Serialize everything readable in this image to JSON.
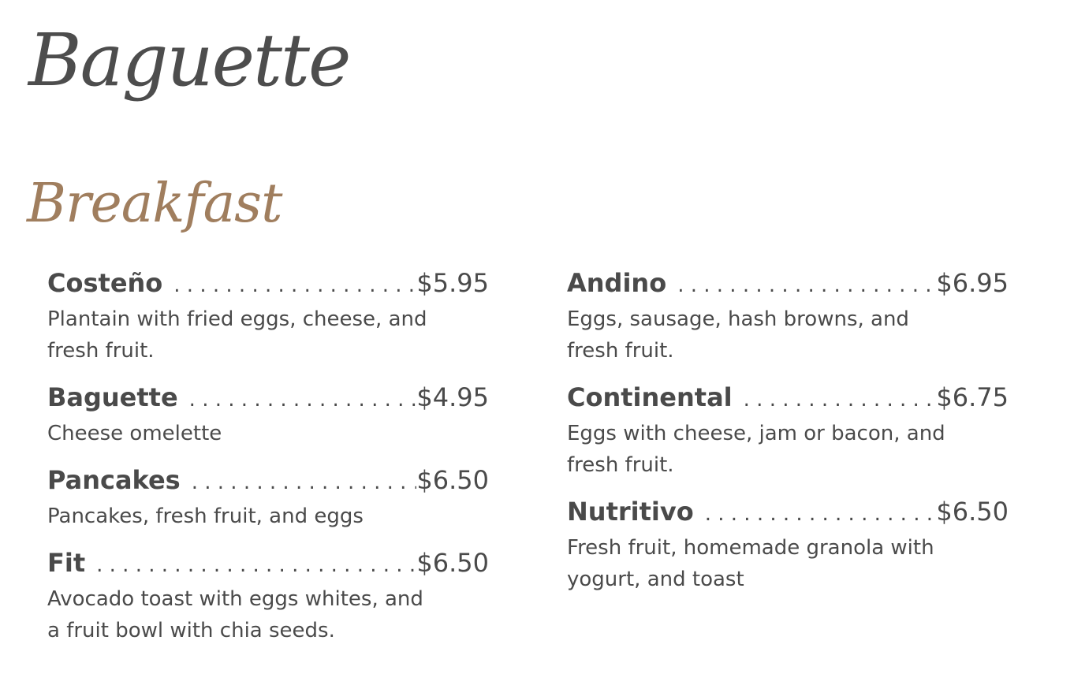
{
  "brand": {
    "name": "Baguette"
  },
  "section": {
    "title": "Breakfast"
  },
  "colors": {
    "text": "#4a4a4a",
    "accent": "#a07e5e",
    "background": "#ffffff"
  },
  "menu": {
    "left": [
      {
        "name": "Costeño",
        "price": "$5.95",
        "description": "Plantain with fried eggs, cheese, and\nfresh fruit."
      },
      {
        "name": "Baguette",
        "price": "$4.95",
        "description": "Cheese omelette"
      },
      {
        "name": "Pancakes",
        "price": "$6.50",
        "description": "Pancakes, fresh fruit, and eggs"
      },
      {
        "name": "Fit",
        "price": "$6.50",
        "description": "Avocado toast with eggs whites, and\na fruit bowl with chia seeds."
      }
    ],
    "right": [
      {
        "name": "Andino",
        "price": "$6.95",
        "description": "Eggs, sausage, hash browns, and\nfresh fruit."
      },
      {
        "name": "Continental",
        "price": "$6.75",
        "description": "Eggs with cheese, jam or bacon, and\nfresh fruit."
      },
      {
        "name": "Nutritivo",
        "price": "$6.50",
        "description": "Fresh fruit, homemade granola with\nyogurt,  and toast"
      }
    ]
  }
}
